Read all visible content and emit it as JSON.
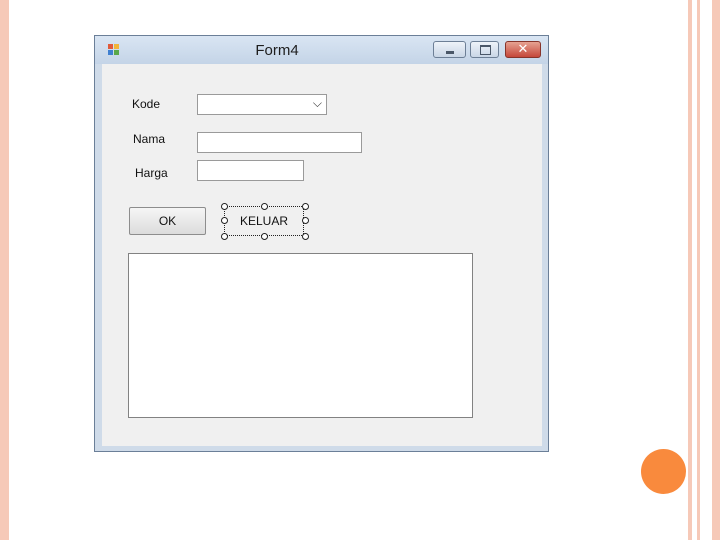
{
  "window": {
    "title": "Form4",
    "controls": {
      "minimize": "minimize",
      "maximize": "maximize",
      "close": "✕"
    }
  },
  "form": {
    "kode_label": "Kode",
    "kode_value": "",
    "nama_label": "Nama",
    "nama_value": "",
    "harga_label": "Harga",
    "harga_value": "",
    "ok_button": "OK",
    "keluar_button": "KELUAR",
    "output_text": ""
  },
  "colors": {
    "slide_stripe": "#f6c9b8",
    "accent_circle": "#f98a3d",
    "form_background": "#f0f0f0",
    "window_frame": "#cfdbe9",
    "close_button": "#c5473a"
  },
  "icons": {
    "app": "winforms-app-icon",
    "dropdown": "chevron-down-icon"
  }
}
